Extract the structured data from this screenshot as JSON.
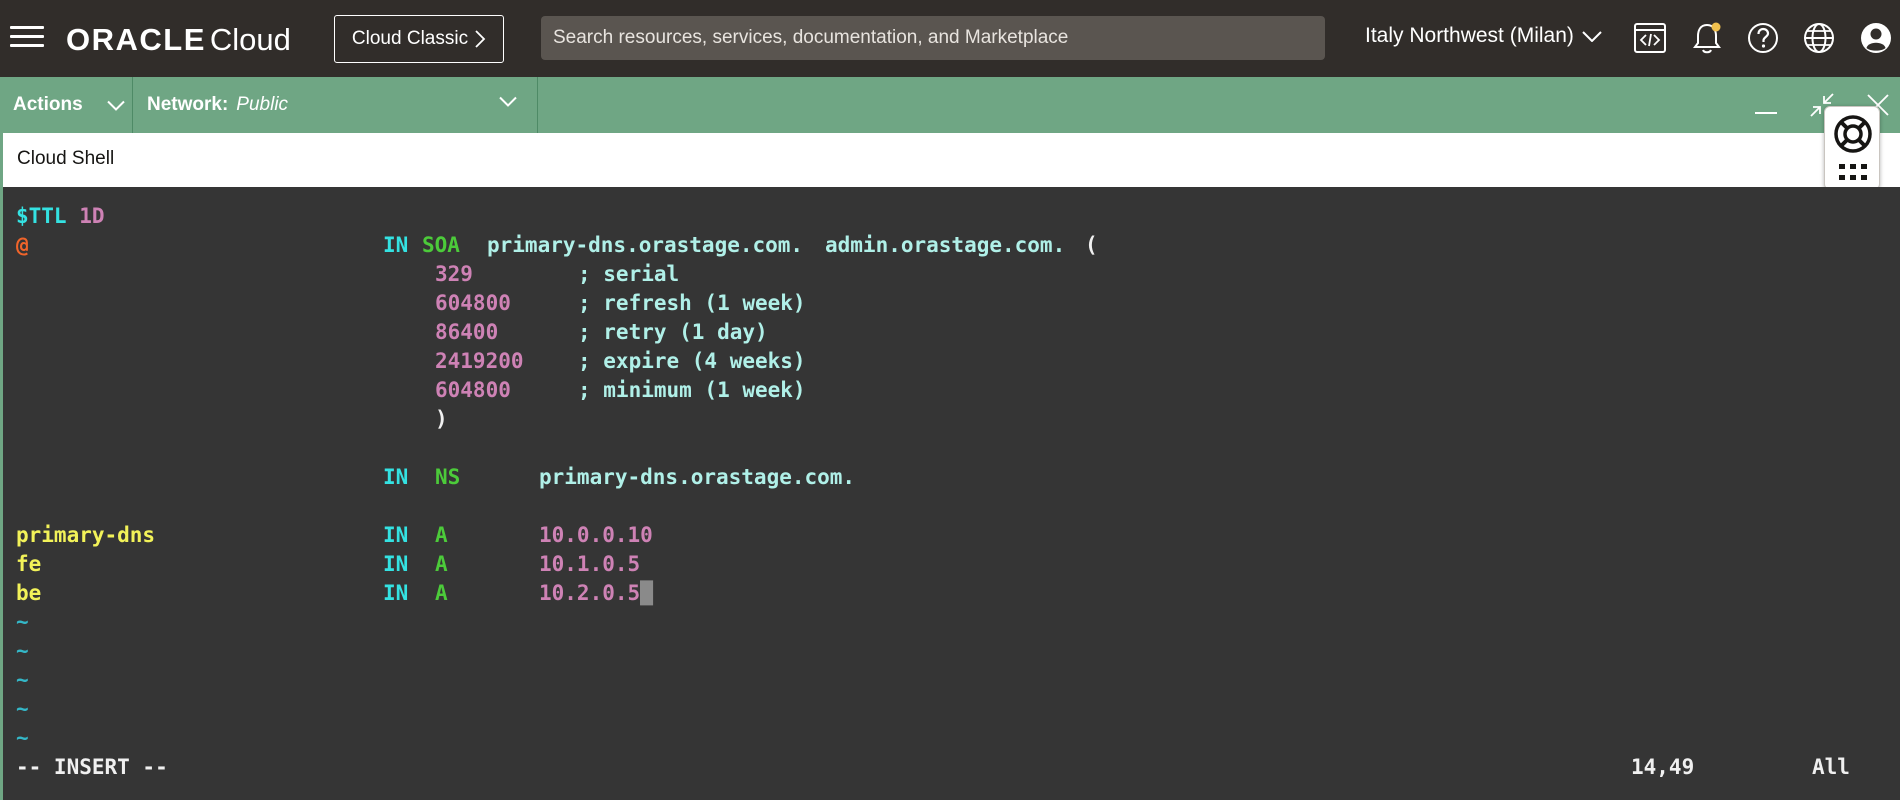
{
  "topbar": {
    "brand_oracle": "ORACLE",
    "brand_cloud": "Cloud",
    "classic_label": "Cloud Classic",
    "search_placeholder": "Search resources, services, documentation, and Marketplace",
    "region_label": "Italy Northwest (Milan)"
  },
  "shellbar": {
    "actions_label": "Actions",
    "network_label": "Network:",
    "network_value": "Public"
  },
  "tabstrip": {
    "tab_label": "Cloud Shell"
  },
  "terminal": {
    "ttl": {
      "directive": "$TTL",
      "value": "1D"
    },
    "soa": {
      "owner": "@",
      "class": "IN",
      "type": "SOA",
      "mname": "primary-dns.orastage.com.",
      "rname": "admin.orastage.com.",
      "open_paren": "(",
      "close_paren": ")",
      "fields": [
        {
          "value": "329",
          "comment": "; serial"
        },
        {
          "value": "604800",
          "comment": "; refresh (1 week)"
        },
        {
          "value": "86400",
          "comment": "; retry (1 day)"
        },
        {
          "value": "2419200",
          "comment": "; expire (4 weeks)"
        },
        {
          "value": "604800",
          "comment": "; minimum (1 week)"
        }
      ]
    },
    "ns": {
      "class": "IN",
      "type": "NS",
      "target": "primary-dns.orastage.com."
    },
    "a_records": [
      {
        "name": "primary-dns",
        "class": "IN",
        "type": "A",
        "address": "10.0.0.10"
      },
      {
        "name": "fe",
        "class": "IN",
        "type": "A",
        "address": "10.1.0.5"
      },
      {
        "name": "be",
        "class": "IN",
        "type": "A",
        "address": "10.2.0.5"
      }
    ],
    "tilde": "~",
    "status": {
      "mode": "-- INSERT --",
      "position": "14,49",
      "scroll": "All"
    }
  },
  "icons": {
    "menu": "hamburger-menu-icon",
    "classic_chevron": "chevron-right-icon",
    "region_chevron": "chevron-down-icon",
    "developer": "code-window-icon",
    "notifications": "bell-icon",
    "help": "question-circle-icon",
    "language": "globe-icon",
    "profile": "user-avatar-icon",
    "minimize": "minimize-icon",
    "restore": "restore-icon",
    "close": "close-icon",
    "support": "lifebuoy-icon",
    "apps": "grid-dots-icon"
  },
  "colors": {
    "topbar_bg": "#312d2a",
    "shellbar_bg": "#6fa684",
    "terminal_bg": "#353535",
    "notification_dot": "#f2c14e"
  }
}
